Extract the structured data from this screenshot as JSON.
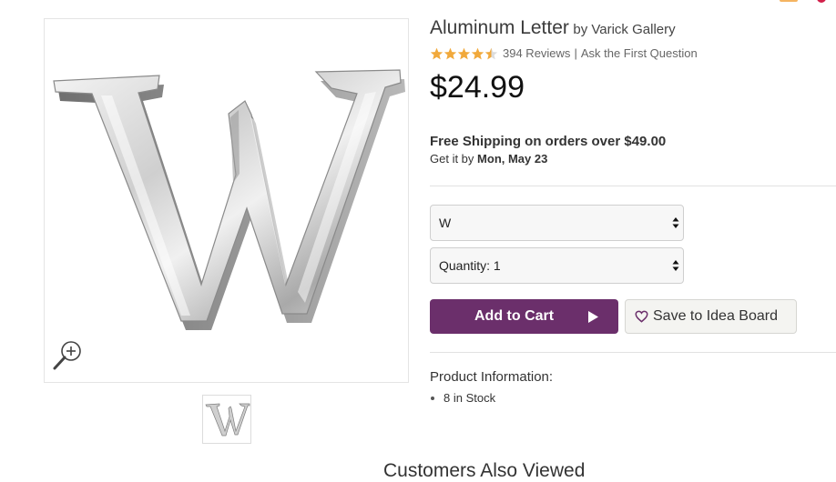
{
  "product": {
    "name": "Aluminum Letter",
    "by_text": "by Varick Gallery",
    "rating": 4.5,
    "rating_max": 5,
    "reviews_text": "394 Reviews",
    "separator": "|",
    "question_text": "Ask the First Question",
    "price": "$24.99"
  },
  "shipping": {
    "headline": "Free Shipping on orders over $49.00",
    "get_it_prefix": "Get it by",
    "delivery_date": "Mon, May 23"
  },
  "options": {
    "letter_selected": "W",
    "quantity_selected": "Quantity: 1"
  },
  "actions": {
    "add_to_cart": "Add to Cart",
    "save_to_idea_board": "Save to Idea Board"
  },
  "info": {
    "heading": "Product Information:",
    "items": [
      "8 in Stock"
    ]
  },
  "sections": {
    "customers_also_viewed": "Customers Also Viewed"
  },
  "colors": {
    "accent_purple": "#6b2f6b",
    "star_gold": "#f1a93b",
    "price_text": "#111111"
  },
  "icons": {
    "zoom": "zoom-in-icon",
    "play": "play-arrow-icon",
    "heart": "heart-outline-icon",
    "star": "star-icon"
  }
}
